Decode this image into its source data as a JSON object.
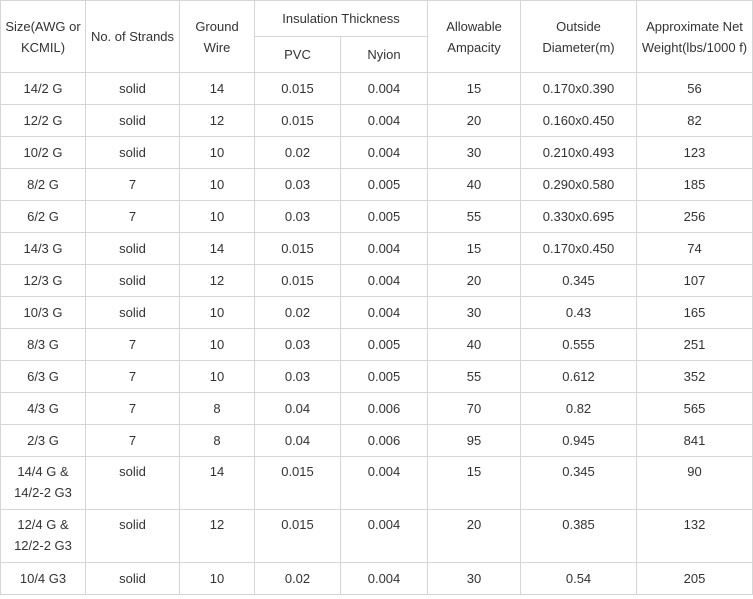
{
  "header": {
    "size": "Size(AWG or KCMIL)",
    "strands": "No. of Strands",
    "ground": "Ground Wire",
    "insulation": "Insulation Thickness",
    "pvc": "PVC",
    "nylon": "Nyion",
    "ampacity": "Allowable Ampacity",
    "diameter": "Outside Diameter(m)",
    "weight": "Approximate Net Weight(lbs/1000 f)"
  },
  "rows": [
    [
      "14/2 G",
      "solid",
      "14",
      "0.015",
      "0.004",
      "15",
      "0.170x0.390",
      "56"
    ],
    [
      "12/2 G",
      "solid",
      "12",
      "0.015",
      "0.004",
      "20",
      "0.160x0.450",
      "82"
    ],
    [
      "10/2 G",
      "solid",
      "10",
      "0.02",
      "0.004",
      "30",
      "0.210x0.493",
      "123"
    ],
    [
      "8/2 G",
      "7",
      "10",
      "0.03",
      "0.005",
      "40",
      "0.290x0.580",
      "185"
    ],
    [
      "6/2 G",
      "7",
      "10",
      "0.03",
      "0.005",
      "55",
      "0.330x0.695",
      "256"
    ],
    [
      "14/3 G",
      "solid",
      "14",
      "0.015",
      "0.004",
      "15",
      "0.170x0.450",
      "74"
    ],
    [
      "12/3 G",
      "solid",
      "12",
      "0.015",
      "0.004",
      "20",
      "0.345",
      "107"
    ],
    [
      "10/3 G",
      "solid",
      "10",
      "0.02",
      "0.004",
      "30",
      "0.43",
      "165"
    ],
    [
      "8/3 G",
      "7",
      "10",
      "0.03",
      "0.005",
      "40",
      "0.555",
      "251"
    ],
    [
      "6/3 G",
      "7",
      "10",
      "0.03",
      "0.005",
      "55",
      "0.612",
      "352"
    ],
    [
      "4/3 G",
      "7",
      "8",
      "0.04",
      "0.006",
      "70",
      "0.82",
      "565"
    ],
    [
      "2/3 G",
      "7",
      "8",
      "0.04",
      "0.006",
      "95",
      "0.945",
      "841"
    ],
    [
      "14/4 G & 14/2-2 G3",
      "solid",
      "14",
      "0.015",
      "0.004",
      "15",
      "0.345",
      "90"
    ],
    [
      "12/4 G & 12/2-2 G3",
      "solid",
      "12",
      "0.015",
      "0.004",
      "20",
      "0.385",
      "132"
    ],
    [
      "10/4 G3",
      "solid",
      "10",
      "0.02",
      "0.004",
      "30",
      "0.54",
      "205"
    ]
  ]
}
